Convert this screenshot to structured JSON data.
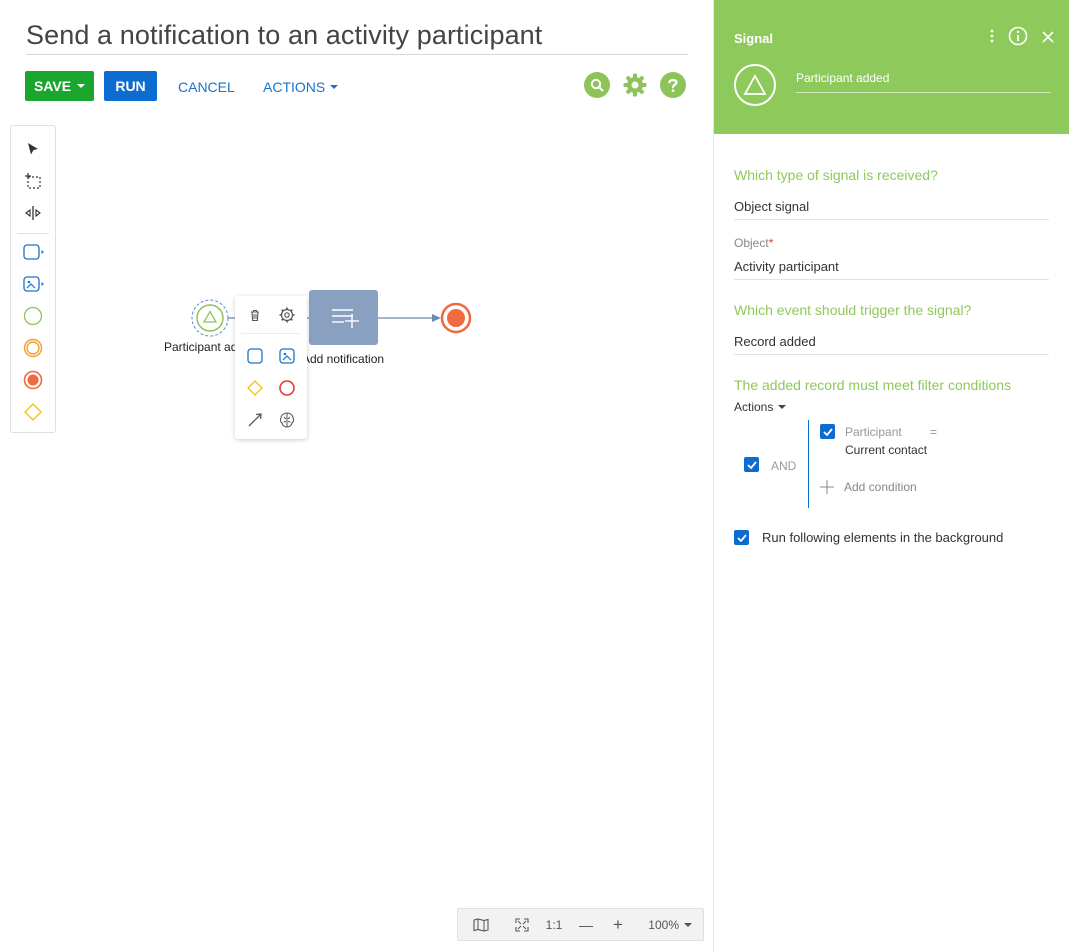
{
  "page": {
    "title": "Send a notification to an activity participant"
  },
  "toolbar": {
    "save_label": "SAVE",
    "run_label": "RUN",
    "cancel_label": "CANCEL",
    "actions_label": "ACTIONS"
  },
  "top_icons": [
    "search-icon",
    "gear-icon",
    "help-icon"
  ],
  "colors": {
    "save": "#1aa62e",
    "run": "#0d6ccf",
    "link": "#1a73c9",
    "accent_green": "#8ec95b",
    "end_event": "#f06a40",
    "task_fill": "#8aa0c0",
    "checkbox": "#0d6ccf"
  },
  "palette": {
    "items": [
      "pointer-icon",
      "select-area-icon",
      "lane-splitter-icon",
      "user-task-icon",
      "script-task-icon",
      "start-event-icon",
      "intermediate-event-icon",
      "end-event-icon",
      "gateway-icon"
    ]
  },
  "diagram": {
    "start_node_label": "Participant ad",
    "task_node_label": "Add notification"
  },
  "context_menu": {
    "items": [
      "delete-icon",
      "settings-icon",
      "task-icon",
      "script-task-icon",
      "gateway-icon",
      "end-event-icon",
      "flow-arrow-icon",
      "ai-icon"
    ]
  },
  "zoom": {
    "one_to_one": "1:1",
    "minus": "—",
    "plus": "+",
    "level": "100%"
  },
  "panel": {
    "title": "Signal",
    "element_name": "Participant added",
    "q_signal_type": "Which type of signal is received?",
    "signal_type_value": "Object signal",
    "object_label": "Object",
    "object_required": "*",
    "object_value": "Activity participant",
    "q_event": "Which event should trigger the signal?",
    "event_value": "Record added",
    "q_filter": "The added record must meet filter conditions",
    "filter_actions": "Actions",
    "filter": {
      "group_operator": "AND",
      "condition_column": "Participant",
      "condition_operator": "=",
      "condition_value": "Current contact",
      "add_condition": "Add condition"
    },
    "background_run_label": "Run following elements in the background"
  }
}
